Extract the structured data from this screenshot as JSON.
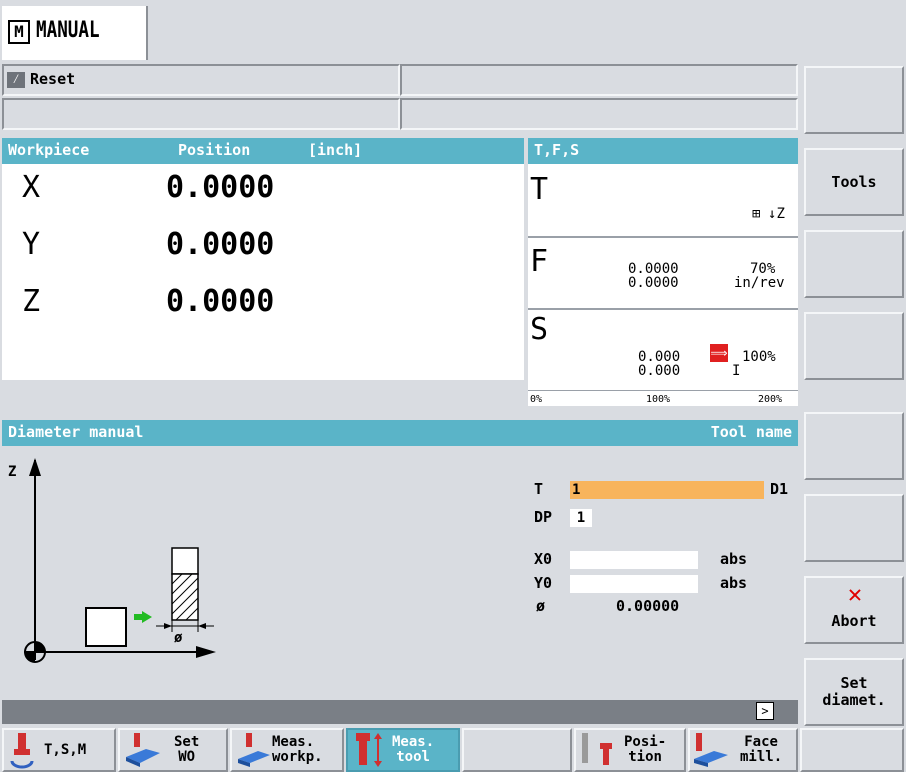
{
  "mode": {
    "title": "MANUAL",
    "icon": "M"
  },
  "status": {
    "reset_label": "Reset"
  },
  "position": {
    "header_left": "Workpiece",
    "header_mid": "Position",
    "header_unit": "[inch]",
    "axes": [
      {
        "name": "X",
        "value": "0.0000"
      },
      {
        "name": "Y",
        "value": "0.0000"
      },
      {
        "name": "Z",
        "value": "0.0000"
      }
    ]
  },
  "tfs": {
    "header": "T,F,S",
    "t_label": "T",
    "t_axis": "Z",
    "f_label": "F",
    "f_value1": "0.0000",
    "f_value2": "0.0000",
    "f_percent": "70%",
    "f_unit": "in/rev",
    "s_label": "S",
    "s_value1": "0.000",
    "s_value2": "0.000",
    "s_percent": "100%",
    "s_gear": "I",
    "scale": [
      "0%",
      "100%",
      "200%"
    ]
  },
  "measure": {
    "header": "Diameter manual",
    "header_right": "Tool name",
    "axis_z": "Z",
    "diameter_symbol": "ø",
    "t_label": "T",
    "t_value": "1",
    "d_label": "D1",
    "dp_label": "DP",
    "dp_value": "1",
    "x0_label": "X0",
    "x0_value": "",
    "x0_unit": "abs",
    "y0_label": "Y0",
    "y0_value": "",
    "y0_unit": "abs",
    "dia_label": "ø",
    "dia_value": "0.00000"
  },
  "vsoft": [
    {
      "label": ""
    },
    {
      "label": "Tools"
    },
    {
      "label": ""
    },
    {
      "label": ""
    },
    {
      "label": ""
    },
    {
      "label": ""
    },
    {
      "label": "Abort"
    },
    {
      "label": "Set\ndiamet."
    }
  ],
  "hsoft": [
    {
      "label": "T,S,M"
    },
    {
      "label": "Set\nWO"
    },
    {
      "label": "Meas.\nworkp."
    },
    {
      "label": "Meas.\ntool"
    },
    {
      "label": ""
    },
    {
      "label": "Posi-\ntion"
    },
    {
      "label": "Face\nmill."
    },
    {
      "label": ""
    }
  ],
  "colors": {
    "header": "#5ab4c8",
    "tool_highlight": "#f8b45c",
    "spindle_icon": "#e02020",
    "abort_icon": "#e00000",
    "arrow": "#22bb22",
    "active_tab": "#5ab4c8"
  }
}
